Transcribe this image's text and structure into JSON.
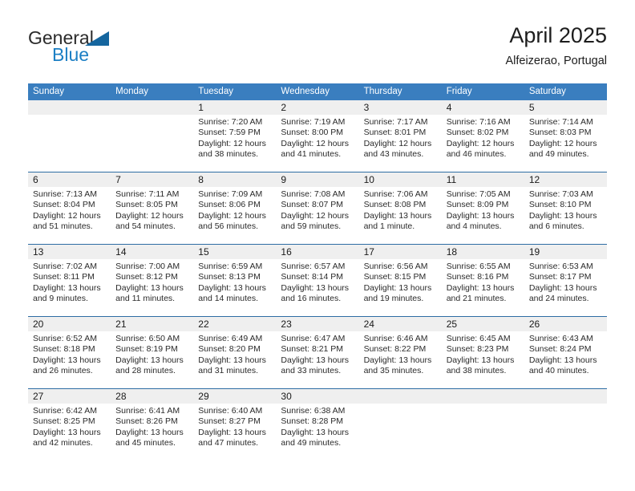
{
  "brand": {
    "name_part1": "General",
    "name_part2": "Blue",
    "logo_icon": "triangle-logo-icon"
  },
  "header": {
    "title": "April 2025",
    "location": "Alfeizerao, Portugal"
  },
  "calendar": {
    "weekday_headers": [
      "Sunday",
      "Monday",
      "Tuesday",
      "Wednesday",
      "Thursday",
      "Friday",
      "Saturday"
    ],
    "accent_color": "#3a7ebf",
    "separator_color": "#2e6da4",
    "daynum_band_color": "#efefef",
    "weeks": [
      [
        {
          "day": "",
          "sunrise": "",
          "sunset": "",
          "daylight_line1": "",
          "daylight_line2": ""
        },
        {
          "day": "",
          "sunrise": "",
          "sunset": "",
          "daylight_line1": "",
          "daylight_line2": ""
        },
        {
          "day": "1",
          "sunrise": "Sunrise: 7:20 AM",
          "sunset": "Sunset: 7:59 PM",
          "daylight_line1": "Daylight: 12 hours",
          "daylight_line2": "and 38 minutes."
        },
        {
          "day": "2",
          "sunrise": "Sunrise: 7:19 AM",
          "sunset": "Sunset: 8:00 PM",
          "daylight_line1": "Daylight: 12 hours",
          "daylight_line2": "and 41 minutes."
        },
        {
          "day": "3",
          "sunrise": "Sunrise: 7:17 AM",
          "sunset": "Sunset: 8:01 PM",
          "daylight_line1": "Daylight: 12 hours",
          "daylight_line2": "and 43 minutes."
        },
        {
          "day": "4",
          "sunrise": "Sunrise: 7:16 AM",
          "sunset": "Sunset: 8:02 PM",
          "daylight_line1": "Daylight: 12 hours",
          "daylight_line2": "and 46 minutes."
        },
        {
          "day": "5",
          "sunrise": "Sunrise: 7:14 AM",
          "sunset": "Sunset: 8:03 PM",
          "daylight_line1": "Daylight: 12 hours",
          "daylight_line2": "and 49 minutes."
        }
      ],
      [
        {
          "day": "6",
          "sunrise": "Sunrise: 7:13 AM",
          "sunset": "Sunset: 8:04 PM",
          "daylight_line1": "Daylight: 12 hours",
          "daylight_line2": "and 51 minutes."
        },
        {
          "day": "7",
          "sunrise": "Sunrise: 7:11 AM",
          "sunset": "Sunset: 8:05 PM",
          "daylight_line1": "Daylight: 12 hours",
          "daylight_line2": "and 54 minutes."
        },
        {
          "day": "8",
          "sunrise": "Sunrise: 7:09 AM",
          "sunset": "Sunset: 8:06 PM",
          "daylight_line1": "Daylight: 12 hours",
          "daylight_line2": "and 56 minutes."
        },
        {
          "day": "9",
          "sunrise": "Sunrise: 7:08 AM",
          "sunset": "Sunset: 8:07 PM",
          "daylight_line1": "Daylight: 12 hours",
          "daylight_line2": "and 59 minutes."
        },
        {
          "day": "10",
          "sunrise": "Sunrise: 7:06 AM",
          "sunset": "Sunset: 8:08 PM",
          "daylight_line1": "Daylight: 13 hours",
          "daylight_line2": "and 1 minute."
        },
        {
          "day": "11",
          "sunrise": "Sunrise: 7:05 AM",
          "sunset": "Sunset: 8:09 PM",
          "daylight_line1": "Daylight: 13 hours",
          "daylight_line2": "and 4 minutes."
        },
        {
          "day": "12",
          "sunrise": "Sunrise: 7:03 AM",
          "sunset": "Sunset: 8:10 PM",
          "daylight_line1": "Daylight: 13 hours",
          "daylight_line2": "and 6 minutes."
        }
      ],
      [
        {
          "day": "13",
          "sunrise": "Sunrise: 7:02 AM",
          "sunset": "Sunset: 8:11 PM",
          "daylight_line1": "Daylight: 13 hours",
          "daylight_line2": "and 9 minutes."
        },
        {
          "day": "14",
          "sunrise": "Sunrise: 7:00 AM",
          "sunset": "Sunset: 8:12 PM",
          "daylight_line1": "Daylight: 13 hours",
          "daylight_line2": "and 11 minutes."
        },
        {
          "day": "15",
          "sunrise": "Sunrise: 6:59 AM",
          "sunset": "Sunset: 8:13 PM",
          "daylight_line1": "Daylight: 13 hours",
          "daylight_line2": "and 14 minutes."
        },
        {
          "day": "16",
          "sunrise": "Sunrise: 6:57 AM",
          "sunset": "Sunset: 8:14 PM",
          "daylight_line1": "Daylight: 13 hours",
          "daylight_line2": "and 16 minutes."
        },
        {
          "day": "17",
          "sunrise": "Sunrise: 6:56 AM",
          "sunset": "Sunset: 8:15 PM",
          "daylight_line1": "Daylight: 13 hours",
          "daylight_line2": "and 19 minutes."
        },
        {
          "day": "18",
          "sunrise": "Sunrise: 6:55 AM",
          "sunset": "Sunset: 8:16 PM",
          "daylight_line1": "Daylight: 13 hours",
          "daylight_line2": "and 21 minutes."
        },
        {
          "day": "19",
          "sunrise": "Sunrise: 6:53 AM",
          "sunset": "Sunset: 8:17 PM",
          "daylight_line1": "Daylight: 13 hours",
          "daylight_line2": "and 24 minutes."
        }
      ],
      [
        {
          "day": "20",
          "sunrise": "Sunrise: 6:52 AM",
          "sunset": "Sunset: 8:18 PM",
          "daylight_line1": "Daylight: 13 hours",
          "daylight_line2": "and 26 minutes."
        },
        {
          "day": "21",
          "sunrise": "Sunrise: 6:50 AM",
          "sunset": "Sunset: 8:19 PM",
          "daylight_line1": "Daylight: 13 hours",
          "daylight_line2": "and 28 minutes."
        },
        {
          "day": "22",
          "sunrise": "Sunrise: 6:49 AM",
          "sunset": "Sunset: 8:20 PM",
          "daylight_line1": "Daylight: 13 hours",
          "daylight_line2": "and 31 minutes."
        },
        {
          "day": "23",
          "sunrise": "Sunrise: 6:47 AM",
          "sunset": "Sunset: 8:21 PM",
          "daylight_line1": "Daylight: 13 hours",
          "daylight_line2": "and 33 minutes."
        },
        {
          "day": "24",
          "sunrise": "Sunrise: 6:46 AM",
          "sunset": "Sunset: 8:22 PM",
          "daylight_line1": "Daylight: 13 hours",
          "daylight_line2": "and 35 minutes."
        },
        {
          "day": "25",
          "sunrise": "Sunrise: 6:45 AM",
          "sunset": "Sunset: 8:23 PM",
          "daylight_line1": "Daylight: 13 hours",
          "daylight_line2": "and 38 minutes."
        },
        {
          "day": "26",
          "sunrise": "Sunrise: 6:43 AM",
          "sunset": "Sunset: 8:24 PM",
          "daylight_line1": "Daylight: 13 hours",
          "daylight_line2": "and 40 minutes."
        }
      ],
      [
        {
          "day": "27",
          "sunrise": "Sunrise: 6:42 AM",
          "sunset": "Sunset: 8:25 PM",
          "daylight_line1": "Daylight: 13 hours",
          "daylight_line2": "and 42 minutes."
        },
        {
          "day": "28",
          "sunrise": "Sunrise: 6:41 AM",
          "sunset": "Sunset: 8:26 PM",
          "daylight_line1": "Daylight: 13 hours",
          "daylight_line2": "and 45 minutes."
        },
        {
          "day": "29",
          "sunrise": "Sunrise: 6:40 AM",
          "sunset": "Sunset: 8:27 PM",
          "daylight_line1": "Daylight: 13 hours",
          "daylight_line2": "and 47 minutes."
        },
        {
          "day": "30",
          "sunrise": "Sunrise: 6:38 AM",
          "sunset": "Sunset: 8:28 PM",
          "daylight_line1": "Daylight: 13 hours",
          "daylight_line2": "and 49 minutes."
        },
        {
          "day": "",
          "sunrise": "",
          "sunset": "",
          "daylight_line1": "",
          "daylight_line2": ""
        },
        {
          "day": "",
          "sunrise": "",
          "sunset": "",
          "daylight_line1": "",
          "daylight_line2": ""
        },
        {
          "day": "",
          "sunrise": "",
          "sunset": "",
          "daylight_line1": "",
          "daylight_line2": ""
        }
      ]
    ]
  }
}
